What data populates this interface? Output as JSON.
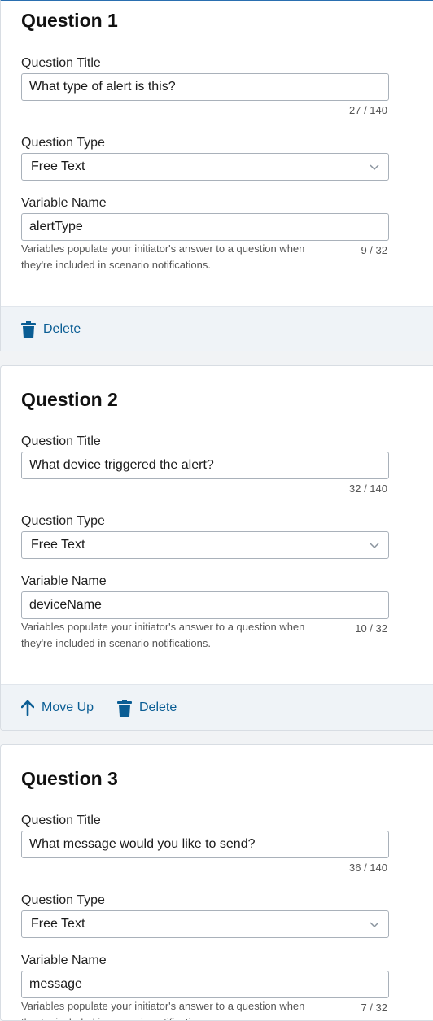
{
  "questions": [
    {
      "title": "Question 1",
      "title_label": "Question Title",
      "title_value": "What type of alert is this?",
      "title_count": "27 / 140",
      "type_label": "Question Type",
      "type_value": "Free Text",
      "var_label": "Variable Name",
      "var_value": "alertType",
      "var_count": "9 / 32",
      "help": "Variables populate your initiator's answer to a question when they're included in scenario notifications.",
      "delete_label": "Delete"
    },
    {
      "title": "Question 2",
      "title_label": "Question Title",
      "title_value": "What device triggered the alert?",
      "title_count": "32 / 140",
      "type_label": "Question Type",
      "type_value": "Free Text",
      "var_label": "Variable Name",
      "var_value": "deviceName",
      "var_count": "10 / 32",
      "help": "Variables populate your initiator's answer to a question when they're included in scenario notifications.",
      "move_up_label": "Move Up",
      "delete_label": "Delete"
    },
    {
      "title": "Question 3",
      "title_label": "Question Title",
      "title_value": "What message would you like to send?",
      "title_count": "36 / 140",
      "type_label": "Question Type",
      "type_value": "Free Text",
      "var_label": "Variable Name",
      "var_value": "message",
      "var_count": "7 / 32",
      "help": "Variables populate your initiator's answer to a question when they're included in scenario notifications."
    }
  ],
  "colors": {
    "accent": "#0a5d94",
    "footer_bg": "#eff3f7",
    "top_border": "#2a6fb0"
  },
  "icons": {
    "delete": "trash-icon",
    "move_up": "arrow-up-icon",
    "select": "chevron-down-icon"
  }
}
